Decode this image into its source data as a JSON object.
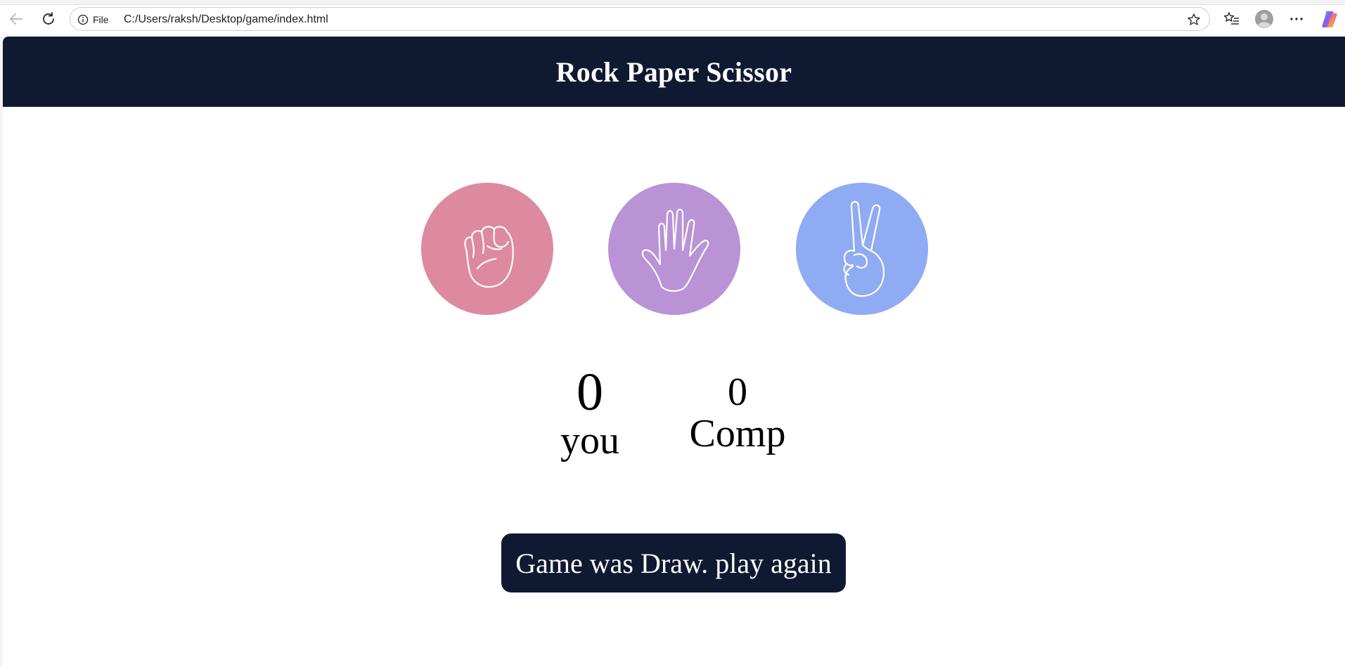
{
  "browser": {
    "site_info_label": "File",
    "url": "C:/Users/raksh/Desktop/game/index.html"
  },
  "page": {
    "title": "Rock Paper Scissor",
    "choices": [
      {
        "id": "rock",
        "icon": "fist-icon",
        "color": "#dd8aa0"
      },
      {
        "id": "paper",
        "icon": "open-hand-icon",
        "color": "#b993d6"
      },
      {
        "id": "scissors",
        "icon": "peace-hand-icon",
        "color": "#8fabf4"
      }
    ],
    "score": {
      "user_value": "0",
      "user_label": "you",
      "comp_value": "0",
      "comp_label": "Comp"
    },
    "message": "Game was Draw. play again"
  },
  "colors": {
    "header_bg": "#0f1a32",
    "message_bg": "#0f1a32"
  }
}
